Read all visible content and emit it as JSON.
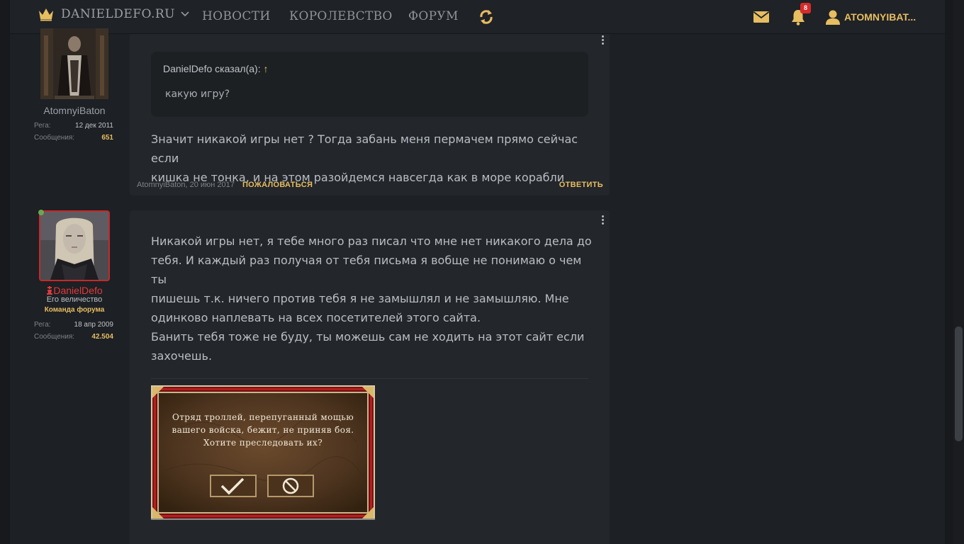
{
  "header": {
    "site_name": "DANIELDEFO.RU",
    "nav": [
      "НОВОСТИ",
      "КОРОЛЕВСТВО",
      "ФОРУМ"
    ],
    "notification_count": "8",
    "username": "ATOMNYIBAT..."
  },
  "post1": {
    "author": {
      "name": "AtomnyiBaton",
      "stats": [
        {
          "label": "Рега:",
          "value": "12 дек 2011"
        },
        {
          "label": "Сообщения:",
          "value": "651"
        }
      ]
    },
    "quote": {
      "author_line": "DanielDefo сказал(а):",
      "arrow": "↑",
      "text": "какую игру?"
    },
    "message_lines": [
      "Значит никакой игры нет ? Тогда забань меня пермачем прямо сейчас если",
      "кишка не тонка, и на этом разойдемся навсегда как в море корабли"
    ],
    "footer": {
      "meta": "AtomnyiBaton, 20 июн 2017",
      "report": "ПОЖАЛОВАТЬСЯ",
      "reply": "ОТВЕТИТЬ"
    }
  },
  "post2": {
    "author": {
      "name": "DanielDefo",
      "title": "Его величество",
      "banner": "Команда форума",
      "stats": [
        {
          "label": "Рега:",
          "value": "18 апр 2009"
        },
        {
          "label": "Сообщения:",
          "value": "42.504"
        }
      ]
    },
    "paragraph1": [
      "Никакой игры нет, я тебе много раз писал что мне нет никакого дела до",
      "тебя. И каждый раз получая от тебя письма я вобще не понимаю о чем ты",
      "пишешь т.к. ничего против тебя я не замышлял и не замышляю. Мне",
      "одинково наплевать на всех посетителей этого сайта."
    ],
    "paragraph2": [
      "Банить тебя тоже не буду, ты можешь сам не ходить на этот сайт если",
      "захочешь."
    ],
    "game_dialog": {
      "lines": [
        "Отряд троллей, перепуганный мощью",
        "вашего войска, бежит, не приняв боя.",
        "Хотите преследовать их?"
      ]
    }
  },
  "colors": {
    "accent": "#e7bd62",
    "danger": "#c22b2b",
    "background": "#1d2024",
    "post_bg": "#23262a"
  }
}
